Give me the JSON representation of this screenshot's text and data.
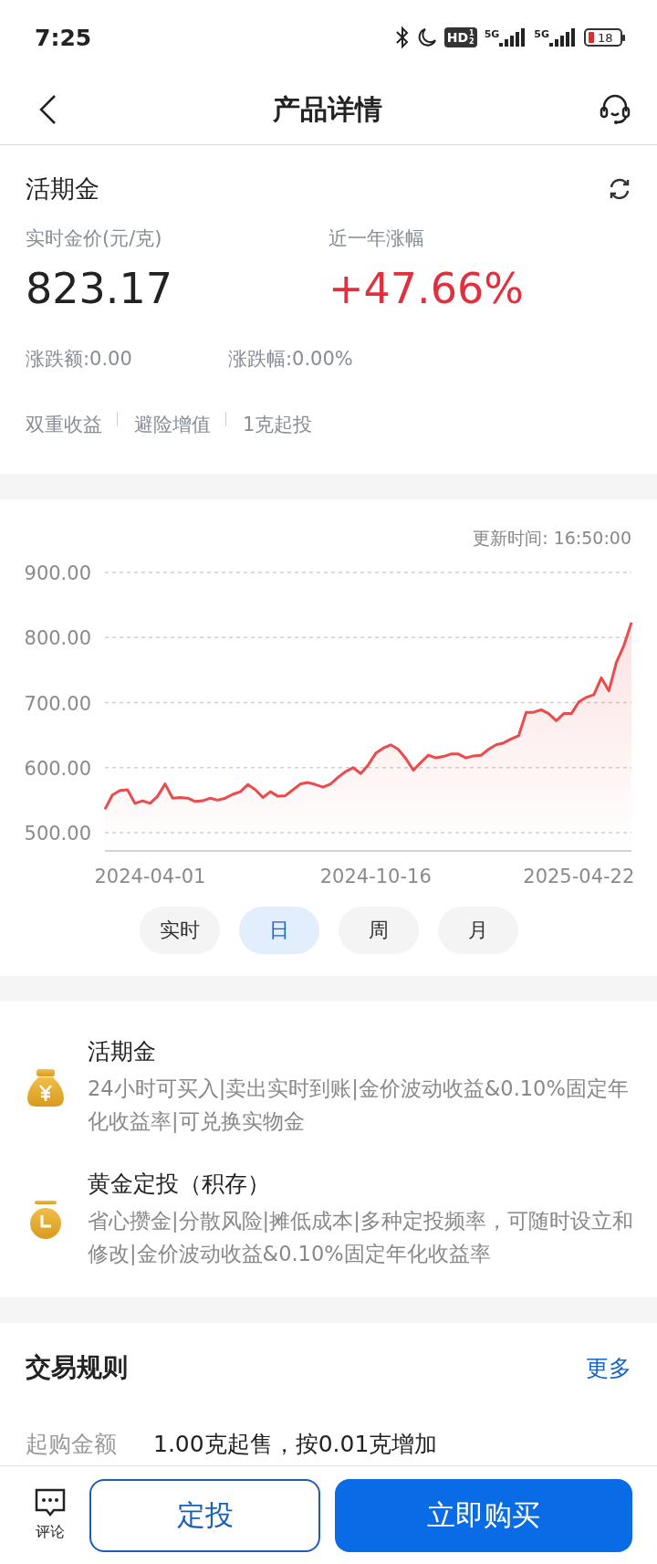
{
  "status_bar": {
    "time": "7:25",
    "hd": "HD",
    "hd_sub": [
      "1",
      "2"
    ],
    "networks": [
      "5G",
      "5G"
    ],
    "battery": "18"
  },
  "header": {
    "title": "产品详情"
  },
  "summary": {
    "name": "活期金",
    "price_label": "实时金价(元/克)",
    "price": "823.17",
    "change_label": "近一年涨幅",
    "change": "+47.66%",
    "amount": "涨跌额:0.00",
    "percent": "涨跌幅:0.00%",
    "tags": [
      "双重收益",
      "避险增值",
      "1克起投"
    ]
  },
  "chart": {
    "updated": "更新时间: 16:50:00",
    "chart_data": {
      "type": "area",
      "grid": true,
      "categories": [
        null,
        null,
        null,
        null,
        null,
        null,
        "2024-04-01",
        null,
        null,
        null,
        null,
        null,
        null,
        null,
        null,
        null,
        null,
        null,
        null,
        null,
        null,
        null,
        null,
        null,
        null,
        null,
        null,
        null,
        null,
        null,
        null,
        null,
        null,
        null,
        null,
        null,
        "2024-10-16",
        null,
        null,
        null,
        null,
        null,
        null,
        null,
        null,
        null,
        null,
        null,
        null,
        null,
        null,
        null,
        null,
        null,
        null,
        null,
        null,
        null,
        null,
        null,
        null,
        null,
        null,
        "2025-04-22",
        null,
        null,
        null,
        null,
        null,
        null,
        null
      ],
      "series": [
        {
          "color": "#ec4a4c",
          "values": [
            536,
            558,
            565,
            566,
            545,
            549,
            545,
            556,
            575,
            553,
            554,
            553,
            548,
            549,
            553,
            550,
            553,
            559,
            563,
            574,
            566,
            554,
            563,
            556,
            557,
            566,
            575,
            577,
            574,
            570,
            575,
            585,
            594,
            600,
            591,
            604,
            622,
            630,
            635,
            628,
            614,
            596,
            608,
            619,
            615,
            617,
            621,
            621,
            615,
            618,
            619,
            628,
            635,
            638,
            644,
            649,
            685,
            685,
            689,
            683,
            672,
            683,
            683,
            701,
            708,
            712,
            738,
            718,
            762,
            788,
            823
          ]
        }
      ],
      "ylim": [
        500,
        900
      ],
      "yticks": [
        {
          "value": 900,
          "label": "900.00"
        },
        {
          "value": 800,
          "label": "800.00"
        },
        {
          "value": 700,
          "label": "700.00"
        },
        {
          "value": 600,
          "label": "600.00"
        },
        {
          "value": 500,
          "label": "500.00"
        }
      ]
    },
    "periods": [
      {
        "label": "实时",
        "selected": false
      },
      {
        "label": "日",
        "selected": true
      },
      {
        "label": "周",
        "selected": false
      },
      {
        "label": "月",
        "selected": false
      }
    ]
  },
  "products": [
    {
      "kind": "bag",
      "title": "活期金",
      "desc": "24小时可买入|卖出实时到账|金价波动收益&0.10%固定年化收益率|可兑换实物金"
    },
    {
      "kind": "clock",
      "title": "黄金定投（积存）",
      "desc": "省心攒金|分散风险|摊低成本|多种定投频率，可随时设立和修改|金价波动收益&0.10%固定年化收益率"
    }
  ],
  "rules": {
    "title": "交易规则",
    "more": "更多",
    "rows": [
      {
        "label": "起购金额",
        "value": "1.00克起售，按0.01克增加"
      }
    ]
  },
  "bottom_bar": {
    "comment": "评论",
    "secondary": "定投",
    "primary": "立即购买"
  }
}
